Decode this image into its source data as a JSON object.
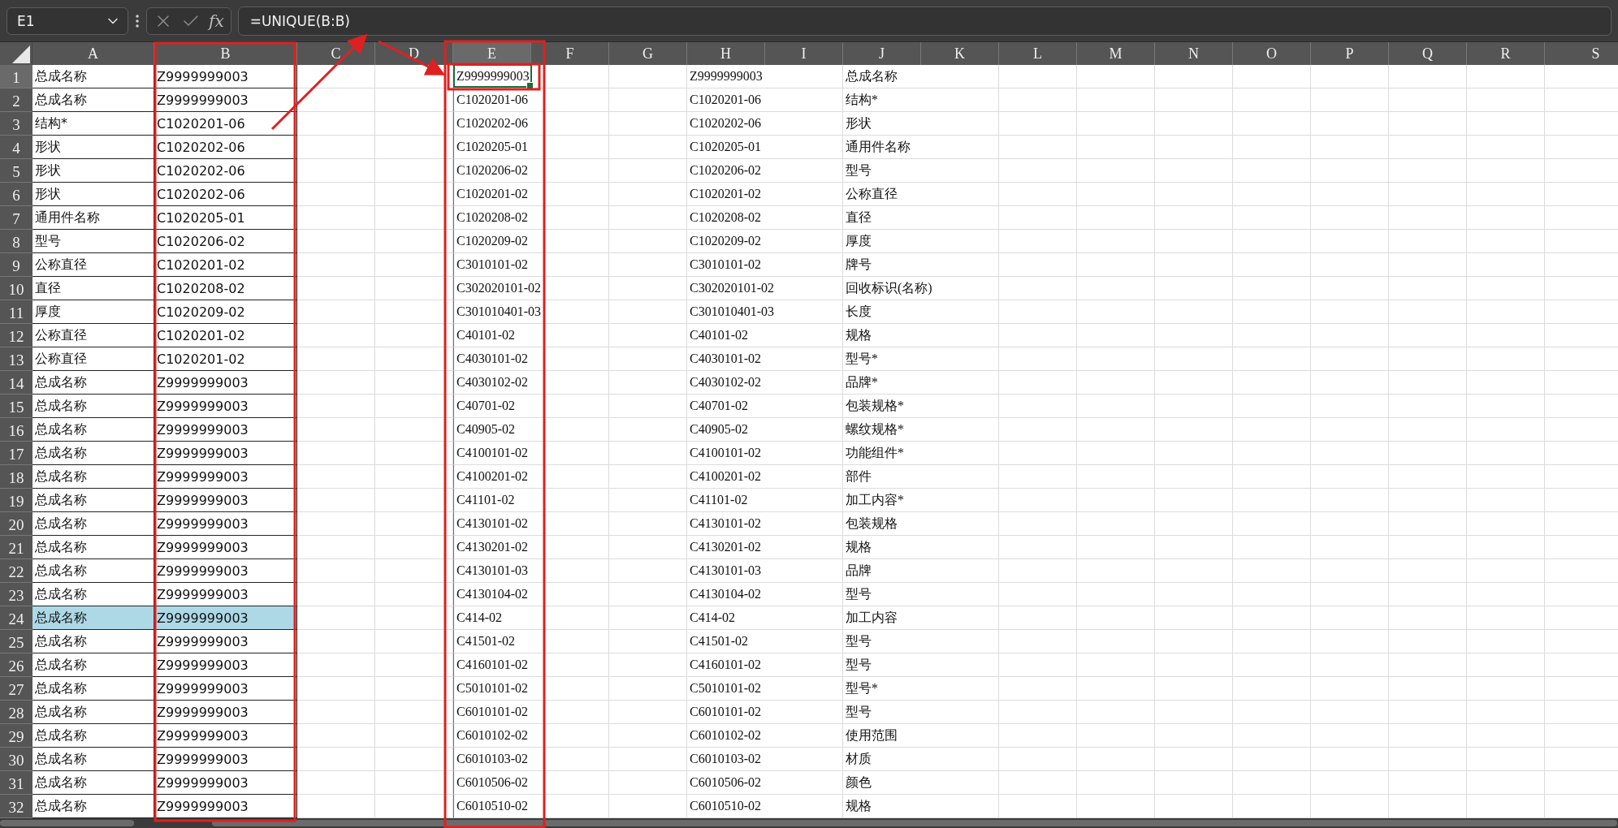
{
  "name_box": "E1",
  "function_button": "fx",
  "formula": "=UNIQUE(B:B)",
  "columns": [
    "A",
    "B",
    "C",
    "D",
    "E",
    "F",
    "G",
    "H",
    "I",
    "J",
    "K",
    "L",
    "M",
    "N",
    "O",
    "P",
    "Q",
    "R",
    "S"
  ],
  "rows": [
    {
      "number": "1",
      "highlighted": false,
      "a": "总成名称",
      "b": "Z9999999003",
      "e": "Z9999999003",
      "e_selected": true,
      "h": "Z9999999003",
      "j": "总成名称"
    },
    {
      "number": "2",
      "highlighted": false,
      "a": "总成名称",
      "b": "Z9999999003",
      "e": "C1020201-06",
      "e_selected": false,
      "h": "C1020201-06",
      "j": "结构*"
    },
    {
      "number": "3",
      "highlighted": false,
      "a": "结构*",
      "b": "C1020201-06",
      "e": "C1020202-06",
      "e_selected": false,
      "h": "C1020202-06",
      "j": "形状"
    },
    {
      "number": "4",
      "highlighted": false,
      "a": "形状",
      "b": "C1020202-06",
      "e": "C1020205-01",
      "e_selected": false,
      "h": "C1020205-01",
      "j": "通用件名称"
    },
    {
      "number": "5",
      "highlighted": false,
      "a": "形状",
      "b": "C1020202-06",
      "e": "C1020206-02",
      "e_selected": false,
      "h": "C1020206-02",
      "j": "型号"
    },
    {
      "number": "6",
      "highlighted": false,
      "a": "形状",
      "b": "C1020202-06",
      "e": "C1020201-02",
      "e_selected": false,
      "h": "C1020201-02",
      "j": "公称直径"
    },
    {
      "number": "7",
      "highlighted": false,
      "a": "通用件名称",
      "b": "C1020205-01",
      "e": "C1020208-02",
      "e_selected": false,
      "h": "C1020208-02",
      "j": "直径"
    },
    {
      "number": "8",
      "highlighted": false,
      "a": "型号",
      "b": "C1020206-02",
      "e": "C1020209-02",
      "e_selected": false,
      "h": "C1020209-02",
      "j": "厚度"
    },
    {
      "number": "9",
      "highlighted": false,
      "a": "公称直径",
      "b": "C1020201-02",
      "e": "C3010101-02",
      "e_selected": false,
      "h": "C3010101-02",
      "j": "牌号"
    },
    {
      "number": "10",
      "highlighted": false,
      "a": "直径",
      "b": "C1020208-02",
      "e": "C302020101-02",
      "e_selected": false,
      "h": "C302020101-02",
      "j": "回收标识(名称)"
    },
    {
      "number": "11",
      "highlighted": false,
      "a": "厚度",
      "b": "C1020209-02",
      "e": "C301010401-03",
      "e_selected": false,
      "h": "C301010401-03",
      "j": "长度"
    },
    {
      "number": "12",
      "highlighted": false,
      "a": "公称直径",
      "b": "C1020201-02",
      "e": "C40101-02",
      "e_selected": false,
      "h": "C40101-02",
      "j": "规格"
    },
    {
      "number": "13",
      "highlighted": false,
      "a": "公称直径",
      "b": "C1020201-02",
      "e": "C4030101-02",
      "e_selected": false,
      "h": "C4030101-02",
      "j": "型号*"
    },
    {
      "number": "14",
      "highlighted": false,
      "a": "总成名称",
      "b": "Z9999999003",
      "e": "C4030102-02",
      "e_selected": false,
      "h": "C4030102-02",
      "j": "品牌*"
    },
    {
      "number": "15",
      "highlighted": false,
      "a": "总成名称",
      "b": "Z9999999003",
      "e": "C40701-02",
      "e_selected": false,
      "h": "C40701-02",
      "j": "包装规格*"
    },
    {
      "number": "16",
      "highlighted": false,
      "a": "总成名称",
      "b": "Z9999999003",
      "e": "C40905-02",
      "e_selected": false,
      "h": "C40905-02",
      "j": "螺纹规格*"
    },
    {
      "number": "17",
      "highlighted": false,
      "a": "总成名称",
      "b": "Z9999999003",
      "e": "C4100101-02",
      "e_selected": false,
      "h": "C4100101-02",
      "j": "功能组件*"
    },
    {
      "number": "18",
      "highlighted": false,
      "a": "总成名称",
      "b": "Z9999999003",
      "e": "C4100201-02",
      "e_selected": false,
      "h": "C4100201-02",
      "j": "部件"
    },
    {
      "number": "19",
      "highlighted": false,
      "a": "总成名称",
      "b": "Z9999999003",
      "e": "C41101-02",
      "e_selected": false,
      "h": "C41101-02",
      "j": "加工内容*"
    },
    {
      "number": "20",
      "highlighted": false,
      "a": "总成名称",
      "b": "Z9999999003",
      "e": "C4130101-02",
      "e_selected": false,
      "h": "C4130101-02",
      "j": "包装规格"
    },
    {
      "number": "21",
      "highlighted": false,
      "a": "总成名称",
      "b": "Z9999999003",
      "e": "C4130201-02",
      "e_selected": false,
      "h": "C4130201-02",
      "j": "规格"
    },
    {
      "number": "22",
      "highlighted": false,
      "a": "总成名称",
      "b": "Z9999999003",
      "e": "C4130101-03",
      "e_selected": false,
      "h": "C4130101-03",
      "j": "品牌"
    },
    {
      "number": "23",
      "highlighted": false,
      "a": "总成名称",
      "b": "Z9999999003",
      "e": "C4130104-02",
      "e_selected": false,
      "h": "C4130104-02",
      "j": "型号"
    },
    {
      "number": "24",
      "highlighted": true,
      "a": "总成名称",
      "b": "Z9999999003",
      "e": "C414-02",
      "e_selected": false,
      "h": "C414-02",
      "j": "加工内容"
    },
    {
      "number": "25",
      "highlighted": false,
      "a": "总成名称",
      "b": "Z9999999003",
      "e": "C41501-02",
      "e_selected": false,
      "h": "C41501-02",
      "j": "型号"
    },
    {
      "number": "26",
      "highlighted": false,
      "a": "总成名称",
      "b": "Z9999999003",
      "e": "C4160101-02",
      "e_selected": false,
      "h": "C4160101-02",
      "j": "型号"
    },
    {
      "number": "27",
      "highlighted": false,
      "a": "总成名称",
      "b": "Z9999999003",
      "e": "C5010101-02",
      "e_selected": false,
      "h": "C5010101-02",
      "j": "型号*"
    },
    {
      "number": "28",
      "highlighted": false,
      "a": "总成名称",
      "b": "Z9999999003",
      "e": "C6010101-02",
      "e_selected": false,
      "h": "C6010101-02",
      "j": "型号"
    },
    {
      "number": "29",
      "highlighted": false,
      "a": "总成名称",
      "b": "Z9999999003",
      "e": "C6010102-02",
      "e_selected": false,
      "h": "C6010102-02",
      "j": "使用范围"
    },
    {
      "number": "30",
      "highlighted": false,
      "a": "总成名称",
      "b": "Z9999999003",
      "e": "C6010103-02",
      "e_selected": false,
      "h": "C6010103-02",
      "j": "材质"
    },
    {
      "number": "31",
      "highlighted": false,
      "a": "总成名称",
      "b": "Z9999999003",
      "e": "C6010506-02",
      "e_selected": false,
      "h": "C6010506-02",
      "j": "颜色"
    },
    {
      "number": "32",
      "highlighted": false,
      "a": "总成名称",
      "b": "Z9999999003",
      "e": "C6010510-02",
      "e_selected": false,
      "h": "C6010510-02",
      "j": "规格"
    }
  ]
}
